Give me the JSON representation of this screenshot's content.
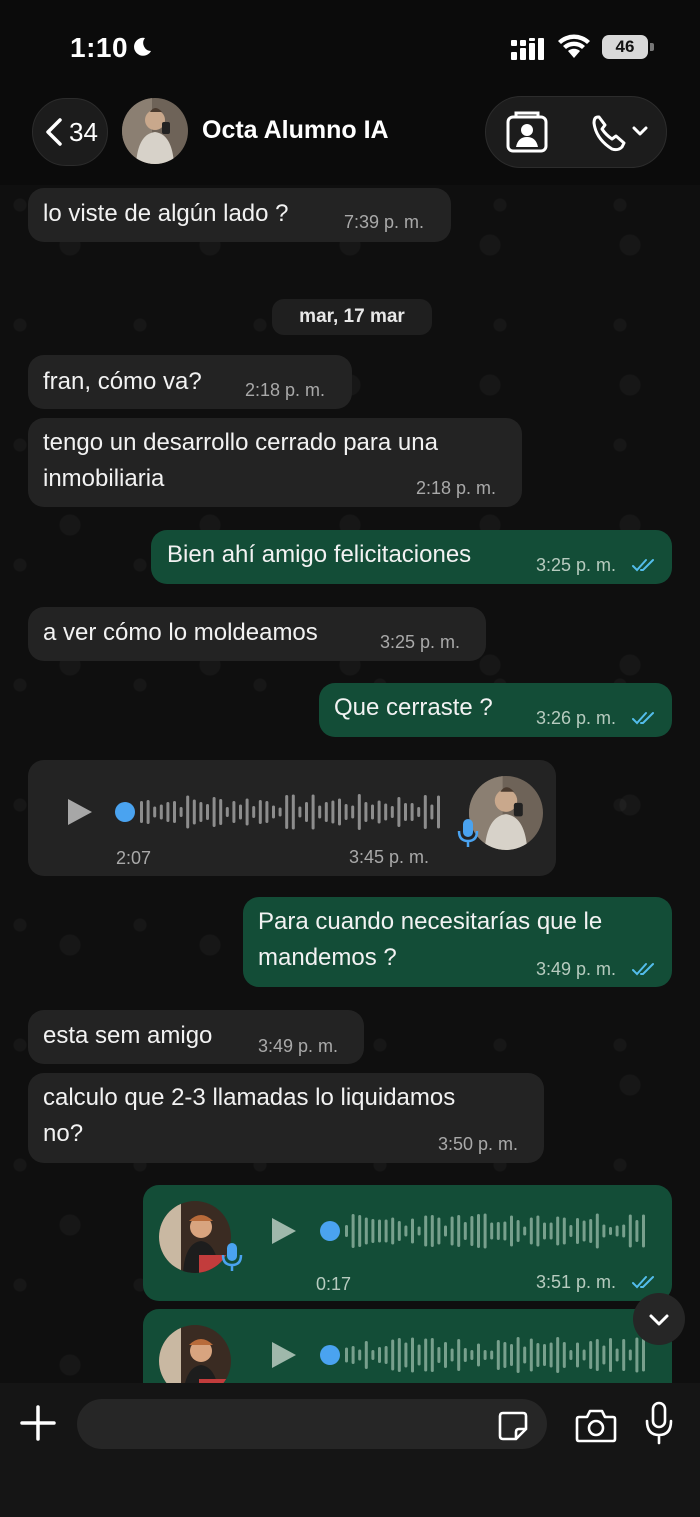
{
  "status_bar": {
    "time": "1:10",
    "battery": "46"
  },
  "header": {
    "back_count": "34",
    "contact_name": "Octa Alumno IA"
  },
  "messages": [
    {
      "text": "lo viste de algún lado ?",
      "time": "7:39 p. m."
    },
    {
      "text": "fran, cómo va?",
      "time": "2:18 p. m."
    },
    {
      "text": "tengo un desarrollo cerrado para una\ninmobiliaria",
      "time": "2:18 p. m."
    },
    {
      "text": "Bien ahí amigo felicitaciones",
      "time": "3:25 p. m."
    },
    {
      "text": "a ver cómo lo moldeamos",
      "time": "3:25 p. m."
    },
    {
      "text": "Que cerraste ?",
      "time": "3:26 p. m."
    },
    {
      "text": "Para cuando necesitarías que le\nmandemos ?",
      "time": "3:49 p. m."
    },
    {
      "text": "esta sem amigo",
      "time": "3:49 p. m."
    },
    {
      "text": "calculo que 2-3 llamadas lo liquidamos\nno?",
      "time": "3:50 p. m."
    }
  ],
  "date_separator": "mar, 17 mar",
  "voice_notes": [
    {
      "duration": "2:07",
      "time": "3:45 p. m."
    },
    {
      "duration": "0:17",
      "time": "3:51 p. m."
    }
  ],
  "colors": {
    "incoming_bubble": "#232323",
    "outgoing_bubble": "#134d37",
    "read_ticks": "#53bdeb",
    "voice_dot": "#4aa3f0"
  },
  "icons": [
    "moon-icon",
    "signal-icon",
    "wifi-icon",
    "chevron-left-icon",
    "contact-card-icon",
    "phone-icon",
    "chevron-down-icon",
    "play-icon",
    "mic-icon",
    "plus-icon",
    "sticker-icon",
    "camera-icon"
  ]
}
